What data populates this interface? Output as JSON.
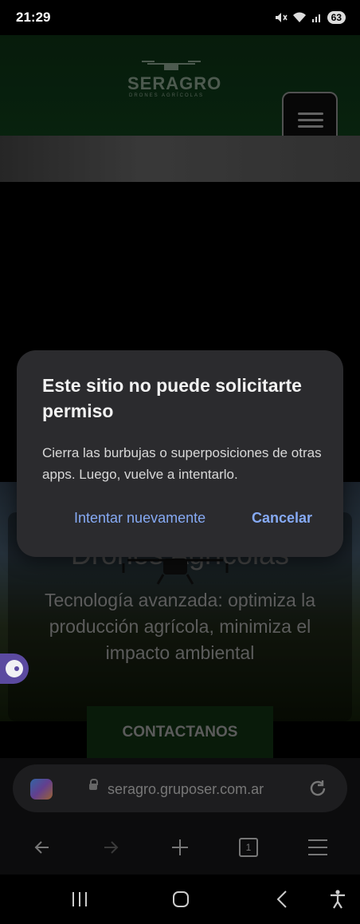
{
  "status_bar": {
    "time": "21:29",
    "battery": "63"
  },
  "site": {
    "logo_text": "SERAGRO",
    "logo_sub": "DRONES AGRÍCOLAS",
    "hero_title": "Drones Agrícolas",
    "hero_subtitle": "Tecnología avanzada: optimiza la producción agrícola, minimiza el impacto ambiental",
    "contact_label": "CONTACTANOS"
  },
  "dialog": {
    "title": "Este sitio no puede solicitarte permiso",
    "message": "Cierra las burbujas o superposiciones de otras apps. Luego, vuelve a intentarlo.",
    "retry_label": "Intentar nuevamente",
    "cancel_label": "Cancelar"
  },
  "browser": {
    "url": "seragro.gruposer.com.ar",
    "tabs_count": "1"
  }
}
